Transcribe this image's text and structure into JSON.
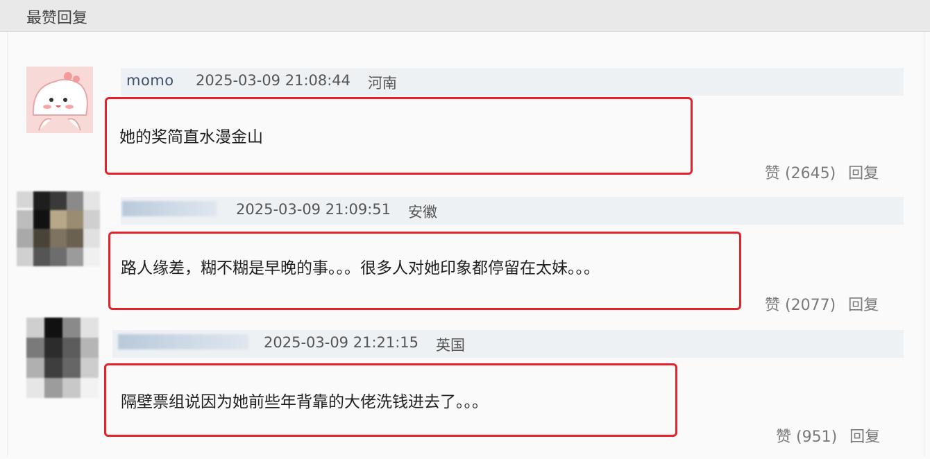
{
  "header": {
    "title": "最赞回复"
  },
  "comments": [
    {
      "username": "momo",
      "datetime": "2025-03-09 21:08:44",
      "location": "河南",
      "text": "她的奖简直水漫金山",
      "likes_label": "赞 (2645)",
      "reply_label": "回复"
    },
    {
      "username": "",
      "datetime": "2025-03-09 21:09:51",
      "location": "安徽",
      "text": "路人缘差，糊不糊是早晚的事。。。很多人对她印象都停留在太妹。。。",
      "likes_label": "赞 (2077)",
      "reply_label": "回复"
    },
    {
      "username": "",
      "datetime": "2025-03-09 21:21:15",
      "location": "英国",
      "text": "隔壁票组说因为她前些年背靠的大佬洗钱进去了。。。",
      "likes_label": "赞 (951)",
      "reply_label": "回复"
    }
  ],
  "colors": {
    "highlight": "#e3222a",
    "meta_bar": "#eef1f4",
    "username": "#3d4f6a"
  }
}
